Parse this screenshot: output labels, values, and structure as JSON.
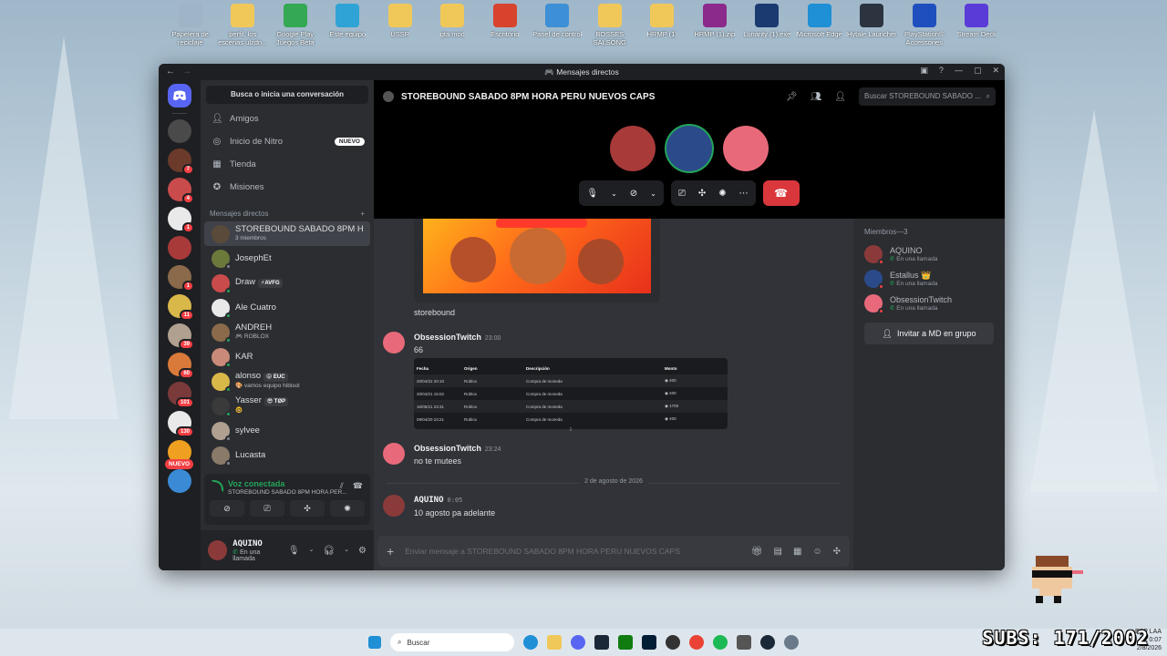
{
  "desktop": {
    "icons": [
      {
        "label": "Papelera de reciclaje",
        "color": "#9fb4c6"
      },
      {
        "label": "perfil, los escenas ulzdn...",
        "color": "#f0c85a"
      },
      {
        "label": "Google Play Juegos Beta",
        "color": "#34a853"
      },
      {
        "label": "Este equipo",
        "color": "#2fa3d6"
      },
      {
        "label": "USSR",
        "color": "#f0c85a"
      },
      {
        "label": "gta mod",
        "color": "#f0c85a"
      },
      {
        "label": "Escritorio",
        "color": "#d8432d"
      },
      {
        "label": "Panel de control",
        "color": "#3d8fd6"
      },
      {
        "label": "BOSSES SALSONG",
        "color": "#f0c85a"
      },
      {
        "label": "HRMP (1)",
        "color": "#f0c85a"
      },
      {
        "label": "HRMP (1).zip",
        "color": "#8b2a8b"
      },
      {
        "label": "Lunarity (1).exe",
        "color": "#1b3a70"
      },
      {
        "label": "Microsoft Edge",
        "color": "#1f8fd6"
      },
      {
        "label": "Hytale Launcher",
        "color": "#2c3440"
      },
      {
        "label": "PlayStation® Accessories",
        "color": "#1f4fbf"
      },
      {
        "label": "Stream Deck",
        "color": "#5a3bd8"
      }
    ]
  },
  "window": {
    "title": "Mensajes directos"
  },
  "rail": {
    "badges": [
      "",
      "7",
      "4",
      "1",
      "",
      "1",
      "11",
      "39",
      "60",
      "101",
      "130",
      "",
      ""
    ],
    "nuevo": "NUEVO"
  },
  "sidebar": {
    "search": "Busca o inicia una conversación",
    "nav": [
      {
        "label": "Amigos",
        "icon": "friends-icon"
      },
      {
        "label": "Inicio de Nitro",
        "icon": "nitro-icon"
      },
      {
        "label": "Tienda",
        "icon": "shop-icon"
      },
      {
        "label": "Misiones",
        "icon": "quests-icon"
      }
    ],
    "nitro_tag": "NUEVO",
    "dm_header": "Mensajes directos",
    "dm_add": "+",
    "dms": [
      {
        "name": "STOREBOUND SABADO 8PM H...",
        "sub": "3 miembros",
        "tag": "",
        "color": "#5a4a3a",
        "active": true,
        "status": ""
      },
      {
        "name": "JosephEt",
        "sub": "",
        "tag": "",
        "color": "#6b7a3a",
        "status": "#80848e"
      },
      {
        "name": "Draw",
        "sub": "",
        "tag": "⚡AVFG",
        "color": "#c94b4b",
        "status": "#23a55a"
      },
      {
        "name": "Ale Cuatro",
        "sub": "",
        "tag": "",
        "color": "#e9e9e9",
        "status": "#23a55a"
      },
      {
        "name": "ANDREH",
        "sub": "🎮 ROBLOX",
        "tag": "",
        "color": "#8a6a4a",
        "status": "#23a55a"
      },
      {
        "name": "KAR",
        "sub": "",
        "tag": "",
        "color": "#c98a7a",
        "status": "#23a55a"
      },
      {
        "name": "alonso",
        "sub": "🎨 vamos equipo hibisol",
        "tag": "😝 EUC",
        "color": "#d9b84a",
        "status": "#23a55a"
      },
      {
        "name": "Yasser",
        "sub": "🤓",
        "tag": "😎 TØP",
        "color": "#3a3a3a",
        "status": "#23a55a"
      },
      {
        "name": "sylvee",
        "sub": "",
        "tag": "",
        "color": "#b0a090",
        "status": "#80848e"
      },
      {
        "name": "Lucasta",
        "sub": "",
        "tag": "",
        "color": "#8a7a6a",
        "status": "#80848e"
      }
    ],
    "voice": {
      "status": "Voz conectada",
      "channel": "STOREBOUND SABADO 8PM HORA PER..."
    },
    "user": {
      "name": "AQUINO",
      "status": "En una llamada"
    }
  },
  "main": {
    "title": "STOREBOUND SABADO 8PM HORA PERU NUEVOS CAPS",
    "search_placeholder": "Buscar STOREBOUND SABADO ...",
    "call_avatars": [
      {
        "color": "#a83a3a",
        "ring": "#000"
      },
      {
        "color": "#2a4a8a",
        "ring": "#23a55a"
      },
      {
        "color": "#e86a7a",
        "ring": "#000"
      }
    ],
    "messages": {
      "embed_caption": "storebound",
      "m1": {
        "author": "ObsessionTwitch",
        "time": "23:00",
        "body": "66"
      },
      "table": {
        "headers": [
          "Fecha",
          "Origen",
          "Descripción",
          "Monto"
        ],
        "rows": [
          [
            "20/04/22 20:10",
            "Roblox",
            "Compra de moneda",
            "◉ 400"
          ],
          [
            "20/04/21 15:02",
            "Roblox",
            "Compra de moneda",
            "◉ 400"
          ],
          [
            "16/05/21 23:31",
            "Roblox",
            "Compra de moneda",
            "◉ 1700"
          ],
          [
            "09/04/20 23:21",
            "Roblox",
            "Compra de moneda",
            "◉ 400"
          ]
        ],
        "page": "1"
      },
      "m2": {
        "author": "ObsessionTwitch",
        "time": "23:24",
        "body": "no te mutees"
      },
      "date_divider": "2 de agosto de 2026",
      "m3": {
        "author": "AQUINO",
        "time": "0:05",
        "body": "10 agosto pa adelante"
      }
    },
    "composer_placeholder": "Enviar mensaje a STOREBOUND SABADO 8PM HORA PERU NUEVOS CAPS"
  },
  "members": {
    "header": "Miembros—3",
    "list": [
      {
        "name": "AQUINO",
        "status": "En una llamada",
        "color": "#8b3a3a"
      },
      {
        "name": "Estallus 👑",
        "status": "En una llamada",
        "color": "#2a4a8a"
      },
      {
        "name": "ObsessionTwitch",
        "status": "En una llamada",
        "color": "#e86a7a"
      }
    ],
    "invite": "Invitar a MD en grupo"
  },
  "taskbar": {
    "search": "Buscar",
    "tray_lang": "ESP LAA",
    "time": "0:07",
    "date": "2/8/2026",
    "subs": "SUBS: 171/2002"
  }
}
